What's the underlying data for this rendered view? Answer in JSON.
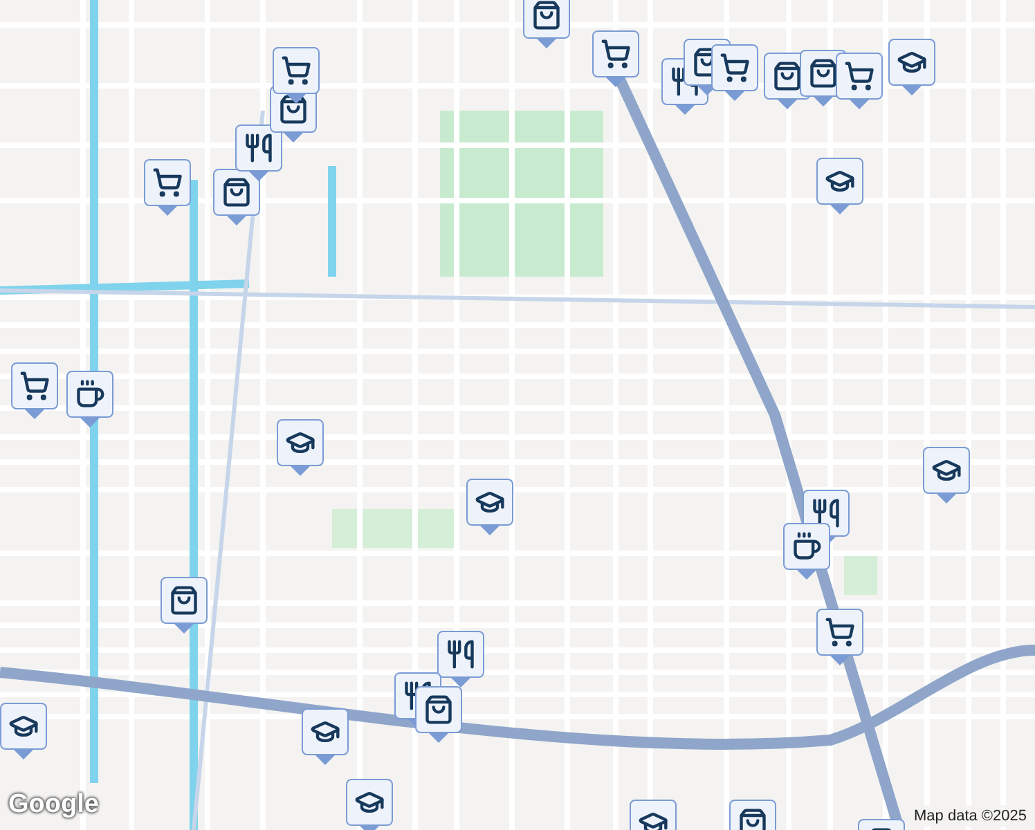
{
  "map": {
    "markers": [
      {
        "kind": "bag"
      },
      {
        "kind": "cart"
      },
      {
        "kind": "fork"
      },
      {
        "kind": "bag"
      },
      {
        "kind": "cart"
      },
      {
        "kind": "bag"
      },
      {
        "kind": "bag"
      },
      {
        "kind": "cart"
      },
      {
        "kind": "cap"
      },
      {
        "kind": "cap"
      },
      {
        "kind": "bag"
      },
      {
        "kind": "cart"
      },
      {
        "kind": "fork"
      },
      {
        "kind": "bag"
      },
      {
        "kind": "cart"
      },
      {
        "kind": "cart"
      },
      {
        "kind": "cup"
      },
      {
        "kind": "cap"
      },
      {
        "kind": "cap"
      },
      {
        "kind": "cap"
      },
      {
        "kind": "fork"
      },
      {
        "kind": "cup"
      },
      {
        "kind": "cart"
      },
      {
        "kind": "bag"
      },
      {
        "kind": "fork"
      },
      {
        "kind": "fork"
      },
      {
        "kind": "bag"
      },
      {
        "kind": "cap"
      },
      {
        "kind": "cap"
      },
      {
        "kind": "cap"
      },
      {
        "kind": "bag"
      },
      {
        "kind": "cap"
      },
      {
        "kind": "bag"
      }
    ]
  },
  "logo": "Google",
  "attribution": "Map data ©2025"
}
